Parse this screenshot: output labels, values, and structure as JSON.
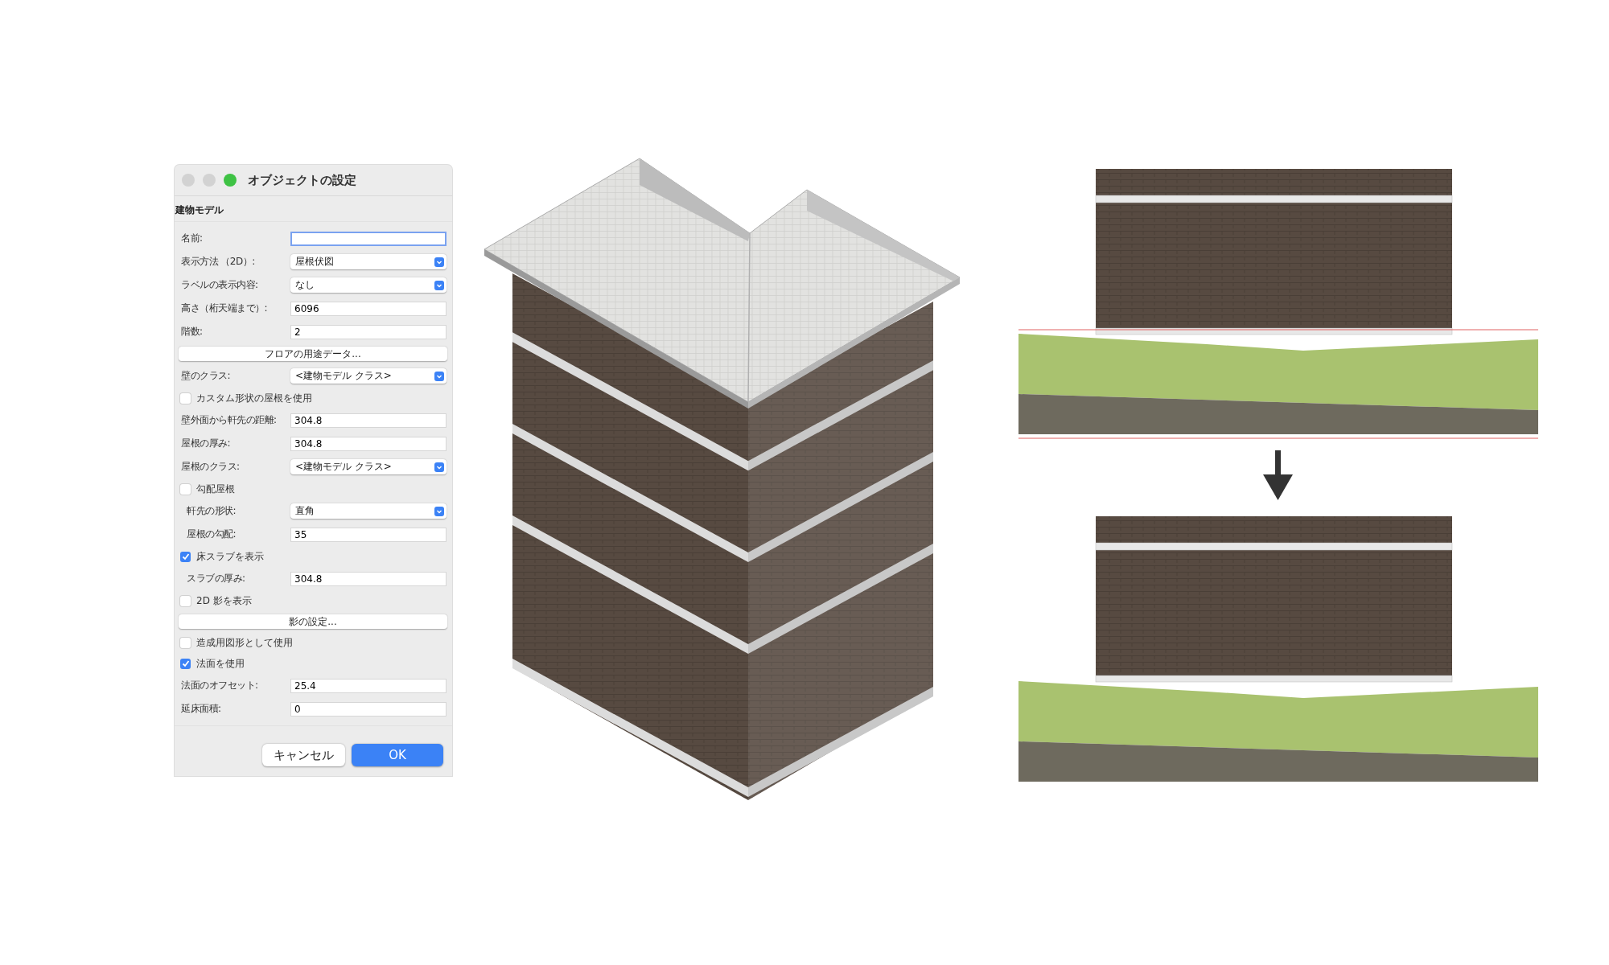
{
  "window": {
    "title": "オブジェクトの設定"
  },
  "section": "建物モデル",
  "rows": [
    {
      "kind": "field",
      "label": "名前:",
      "value": "",
      "focused": true,
      "indented": false
    },
    {
      "kind": "select",
      "label": "表示方法 （2D）:",
      "value": "屋根伏図",
      "indented": false
    },
    {
      "kind": "select",
      "label": "ラベルの表示内容:",
      "value": "なし",
      "indented": false
    },
    {
      "kind": "field",
      "label": "高さ（桁天端まで）:",
      "value": "6096",
      "focused": false,
      "indented": false
    },
    {
      "kind": "field",
      "label": "階数:",
      "value": "2",
      "focused": false,
      "indented": false
    },
    {
      "kind": "button",
      "label": "フロアの用途データ..."
    },
    {
      "kind": "select",
      "label": "壁のクラス:",
      "value": "<建物モデル クラス>",
      "indented": false
    },
    {
      "kind": "checkbox",
      "label": "カスタム形状の屋根を使用",
      "checked": false
    },
    {
      "kind": "field",
      "label": "壁外面から軒先の距離:",
      "value": "304.8",
      "focused": false,
      "indented": false
    },
    {
      "kind": "field",
      "label": "屋根の厚み:",
      "value": "304.8",
      "focused": false,
      "indented": false
    },
    {
      "kind": "select",
      "label": "屋根のクラス:",
      "value": "<建物モデル クラス>",
      "indented": false
    },
    {
      "kind": "checkbox",
      "label": "勾配屋根",
      "checked": false
    },
    {
      "kind": "select",
      "label": "軒先の形状:",
      "value": "直角",
      "indented": true
    },
    {
      "kind": "field",
      "label": "屋根の勾配:",
      "value": "35",
      "focused": false,
      "indented": true
    },
    {
      "kind": "checkbox",
      "label": "床スラブを表示",
      "checked": true
    },
    {
      "kind": "field",
      "label": "スラブの厚み:",
      "value": "304.8",
      "focused": false,
      "indented": true
    },
    {
      "kind": "checkbox",
      "label": "2D 影を表示",
      "checked": false
    },
    {
      "kind": "button",
      "label": "影の設定..."
    },
    {
      "kind": "checkbox",
      "label": "造成用図形として使用",
      "checked": false
    },
    {
      "kind": "checkbox",
      "label": "法面を使用",
      "checked": true
    },
    {
      "kind": "field",
      "label": "法面のオフセット:",
      "value": "25.4",
      "focused": false,
      "indented": false
    },
    {
      "kind": "field",
      "label": "延床面積:",
      "value": "0",
      "focused": false,
      "indented": false
    }
  ],
  "buttons": [
    {
      "label": "キャンセル",
      "kind": "cancel"
    },
    {
      "label": "OK",
      "kind": "default"
    }
  ]
}
